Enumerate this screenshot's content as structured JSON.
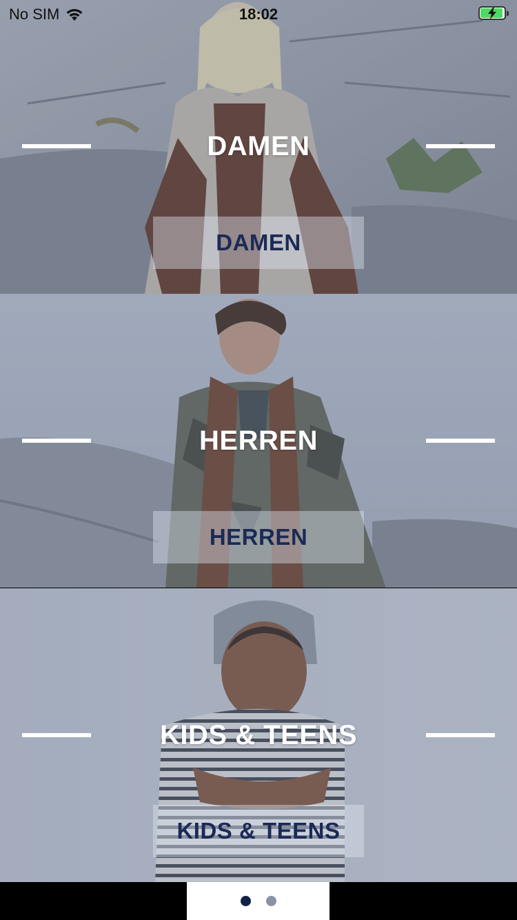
{
  "status_bar": {
    "carrier": "No SIM",
    "time": "18:02",
    "battery_color": "#4cd964"
  },
  "categories": [
    {
      "heading": "DAMEN",
      "button_label": "DAMEN"
    },
    {
      "heading": "HERREN",
      "button_label": "HERREN"
    },
    {
      "heading": "KIDS & TEENS",
      "button_label": "KIDS & TEENS"
    }
  ],
  "pagination": {
    "page_count": 2,
    "active_page": 1
  },
  "colors": {
    "button_text": "#1b2a55",
    "dot_active": "#102347",
    "dot_inactive": "#8a93a5"
  }
}
